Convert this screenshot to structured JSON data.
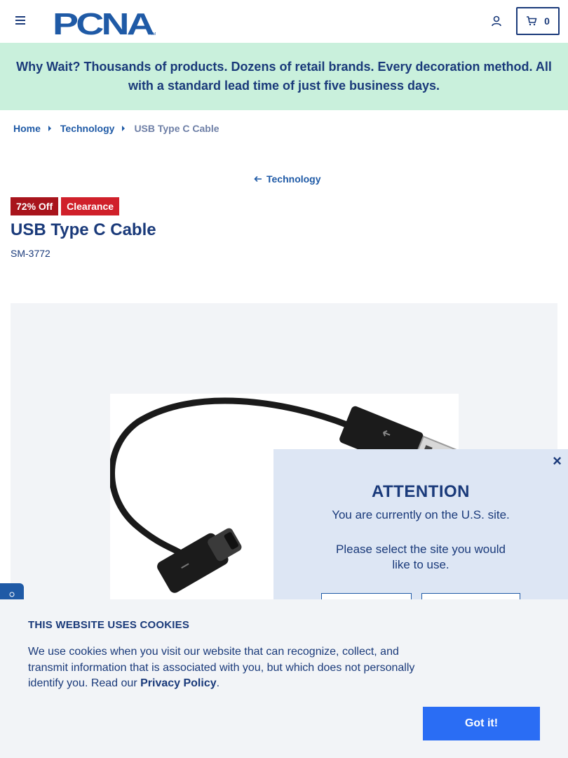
{
  "header": {
    "logo_text": "PCNA",
    "logo_tm": "TM",
    "cart_count": "0"
  },
  "promo": {
    "text": "Why Wait? Thousands of products. Dozens of retail brands. Every decoration method. All with a standard lead time of just five business days."
  },
  "breadcrumb": {
    "items": [
      "Home",
      "Technology"
    ],
    "current": "USB Type C Cable"
  },
  "back_link": "Technology",
  "badges": {
    "discount": "72% Off",
    "status": "Clearance"
  },
  "product": {
    "title": "USB Type C Cable",
    "sku": "SM-3772"
  },
  "attention": {
    "close": "×",
    "title": "ATTENTION",
    "line1": "You are currently on the U.S. site.",
    "line2": "Please select the site you would like to use."
  },
  "cookie": {
    "title": "THIS WEBSITE USES COOKIES",
    "text_before": "We use cookies when you visit our website that can recognize, collect, and transmit information that is associated with you, but which does not personally identify you. Read our ",
    "link": "Privacy Policy",
    "text_after": ".",
    "button": "Got it!"
  },
  "colors": {
    "navy": "#1a3a7a",
    "link_blue": "#1f5aa6",
    "promo_bg": "#c9f0dc",
    "badge_off": "#a8141c",
    "badge_clearance": "#d0202a",
    "modal_bg": "#dde6f4",
    "button_blue": "#2a6df4"
  },
  "icons": [
    "menu-icon",
    "account-icon",
    "cart-icon",
    "arrow-left-icon",
    "close-icon"
  ]
}
